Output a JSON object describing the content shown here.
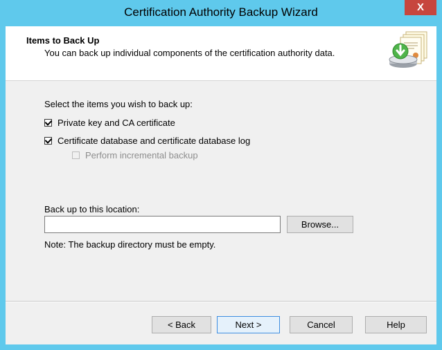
{
  "window": {
    "title": "Certification Authority Backup Wizard",
    "close_glyph": "X"
  },
  "header": {
    "title": "Items to Back Up",
    "subtitle": "You can back up individual components of the certification authority data."
  },
  "content": {
    "instruction": "Select the items you wish to back up:",
    "checkboxes": [
      {
        "label": "Private key and CA certificate",
        "checked": true,
        "enabled": true
      },
      {
        "label": "Certificate database and certificate database log",
        "checked": true,
        "enabled": true
      },
      {
        "label": "Perform incremental backup",
        "checked": false,
        "enabled": false
      }
    ],
    "location_label": "Back up to this location:",
    "location_value": "",
    "browse_label": "Browse...",
    "note": "Note: The backup directory must be empty."
  },
  "footer": {
    "back_label": "< Back",
    "next_label": "Next >",
    "cancel_label": "Cancel",
    "help_label": "Help"
  },
  "colors": {
    "frame": "#5fc9ec",
    "close_button": "#c7463e",
    "default_button_border": "#3d8de0"
  }
}
